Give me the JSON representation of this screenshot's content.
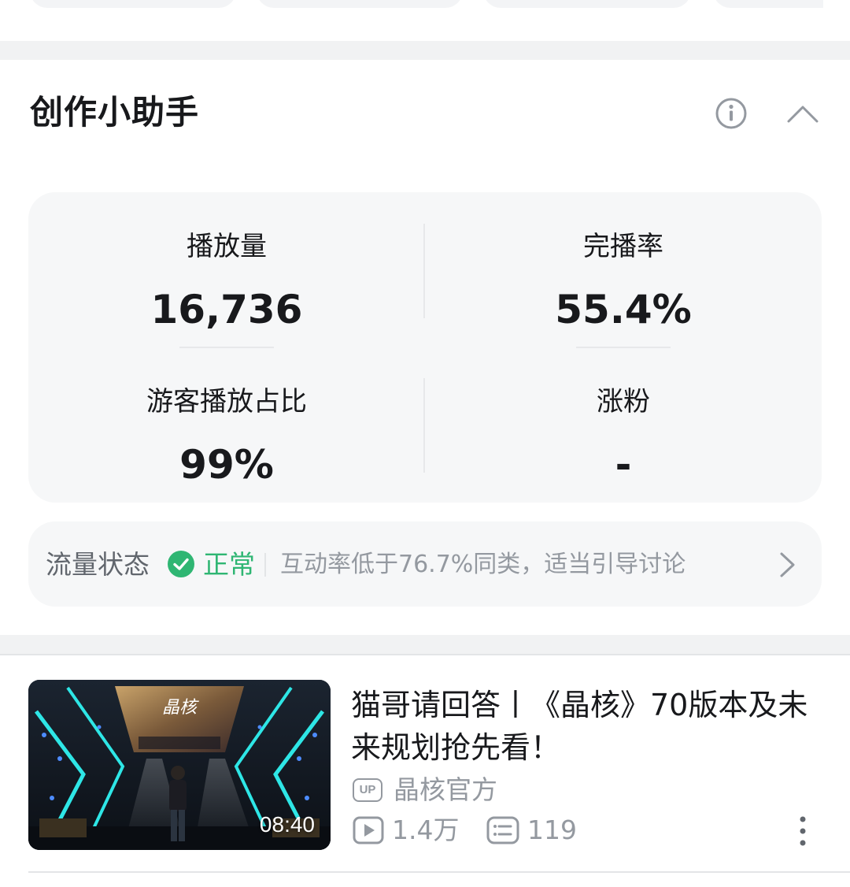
{
  "assistant": {
    "title": "创作小助手",
    "info_icon": "info-circle-icon",
    "collapse_icon": "chevron-up-icon"
  },
  "stats": [
    {
      "label": "播放量",
      "value": "16,736"
    },
    {
      "label": "完播率",
      "value": "55.4%"
    },
    {
      "label": "游客播放占比",
      "value": "99%"
    },
    {
      "label": "涨粉",
      "value": "-"
    }
  ],
  "traffic": {
    "label": "流量状态",
    "status": "正常",
    "status_color": "#2fb673",
    "tip": "互动率低于76.7%同类，适当引导讨论",
    "arrow_icon": "chevron-right-icon"
  },
  "video": {
    "title": "猫哥请回答丨《晶核》70版本及未来规划抢先看！",
    "duration": "08:40",
    "up_badge": "UP",
    "author": "晶核官方",
    "plays": "1.4万",
    "comments": "119",
    "thumb_title_logo": "晶核"
  }
}
